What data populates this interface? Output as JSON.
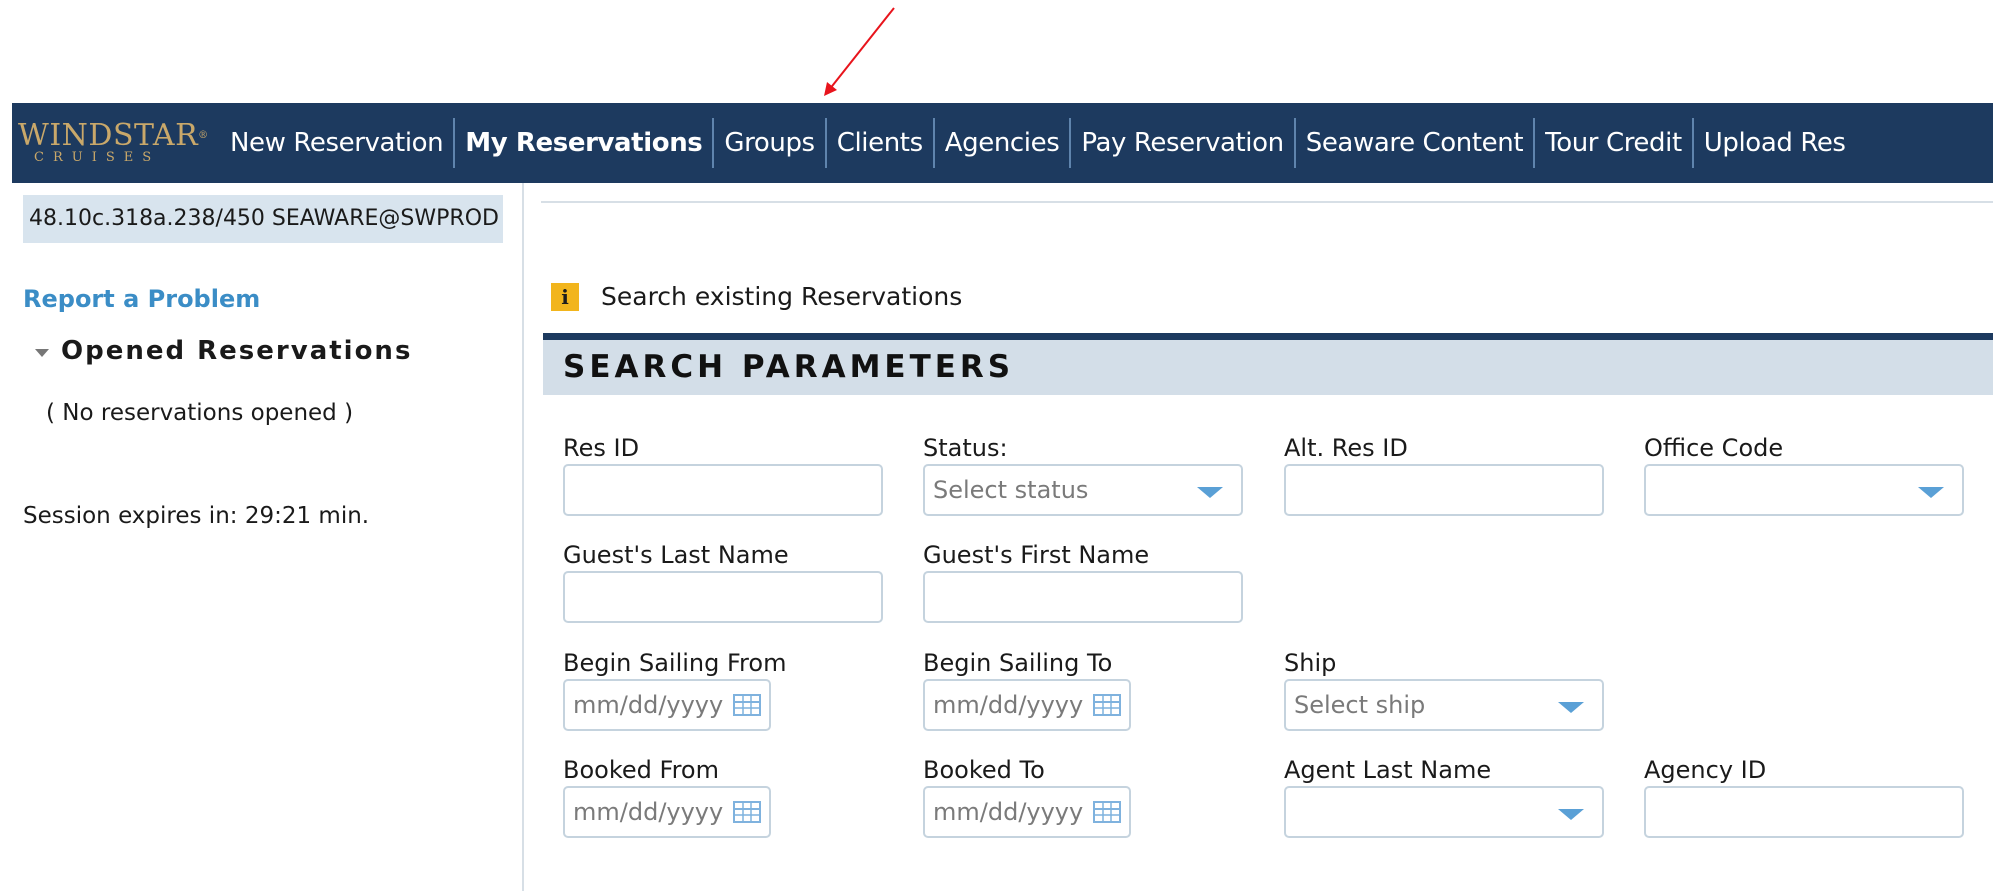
{
  "colors": {
    "nav_bg": "#1d3a5f",
    "accent_link": "#3b8dc6",
    "logo_gold": "#c9a86a",
    "info_icon": "#f2b51c",
    "annotation_arrow": "#e8141c"
  },
  "logo": {
    "main": "WINDSTAR",
    "sub": "CRUISES"
  },
  "nav": {
    "items": [
      {
        "label": "New Reservation",
        "active": false
      },
      {
        "label": "My Reservations",
        "active": true
      },
      {
        "label": "Groups",
        "active": false
      },
      {
        "label": "Clients",
        "active": false
      },
      {
        "label": "Agencies",
        "active": false
      },
      {
        "label": "Pay Reservation",
        "active": false
      },
      {
        "label": "Seaware Content",
        "active": false
      },
      {
        "label": "Tour Credit",
        "active": false
      },
      {
        "label": "Upload Res",
        "active": false
      }
    ]
  },
  "sidebar": {
    "session_id": "48.10c.318a.238/450 SEAWARE@SWPROD",
    "report_link": "Report a Problem",
    "opened_title": "Opened Reservations",
    "no_reservations": "( No reservations opened )",
    "session_expires": "Session expires in: 29:21 min."
  },
  "main": {
    "info_icon": "i",
    "info_text": "Search existing Reservations",
    "section_title": "SEARCH PARAMETERS",
    "fields": {
      "res_id": {
        "label": "Res ID",
        "value": ""
      },
      "status": {
        "label": "Status:",
        "placeholder": "Select status"
      },
      "alt_res_id": {
        "label": "Alt. Res ID",
        "value": ""
      },
      "office_code": {
        "label": "Office Code",
        "placeholder": ""
      },
      "guest_last": {
        "label": "Guest's Last Name",
        "value": ""
      },
      "guest_first": {
        "label": "Guest's First Name",
        "value": ""
      },
      "begin_from": {
        "label": "Begin Sailing From",
        "placeholder": "mm/dd/yyyy"
      },
      "begin_to": {
        "label": "Begin Sailing To",
        "placeholder": "mm/dd/yyyy"
      },
      "ship": {
        "label": "Ship",
        "placeholder": "Select ship"
      },
      "booked_from": {
        "label": "Booked From",
        "placeholder": "mm/dd/yyyy"
      },
      "booked_to": {
        "label": "Booked To",
        "placeholder": "mm/dd/yyyy"
      },
      "agent_last": {
        "label": "Agent Last Name",
        "placeholder": ""
      },
      "agency_id": {
        "label": "Agency ID",
        "value": ""
      }
    }
  }
}
